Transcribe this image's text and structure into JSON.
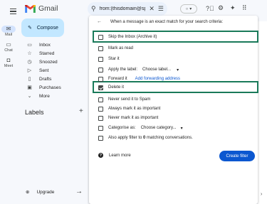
{
  "app": {
    "name": "Gmail"
  },
  "search": {
    "query": "from:(thisdomain@span"
  },
  "rail": [
    {
      "label": "Mail",
      "icon": "mail-icon",
      "glyph": "✉"
    },
    {
      "label": "Chat",
      "icon": "chat-icon",
      "glyph": "▭"
    },
    {
      "label": "Meet",
      "icon": "meet-icon",
      "glyph": "◘"
    }
  ],
  "compose": {
    "label": "Compose"
  },
  "nav": [
    {
      "label": "Inbox",
      "icon": "inbox-icon",
      "glyph": "▭"
    },
    {
      "label": "Starred",
      "icon": "star-icon",
      "glyph": "☆"
    },
    {
      "label": "Snoozed",
      "icon": "clock-icon",
      "glyph": "◷"
    },
    {
      "label": "Sent",
      "icon": "send-icon",
      "glyph": "▷"
    },
    {
      "label": "Drafts",
      "icon": "draft-icon",
      "glyph": "▯"
    },
    {
      "label": "Purchases",
      "icon": "purchases-icon",
      "glyph": "▣"
    },
    {
      "label": "More",
      "icon": "chevron-down-icon",
      "glyph": "⌄"
    }
  ],
  "labels": {
    "title": "Labels"
  },
  "upgrade": {
    "label": "Upgrade"
  },
  "filter": {
    "header": "When a message is an exact match for your search criteria:",
    "options": {
      "skip_inbox": "Skip the Inbox (Archive it)",
      "mark_read": "Mark as read",
      "star": "Star it",
      "apply_label": "Apply the label:",
      "apply_label_value": "Choose label...",
      "forward": "Forward it",
      "forward_link": "Add forwarding address",
      "delete": "Delete it",
      "never_spam": "Never send it to Spam",
      "always_important": "Always mark it as important",
      "never_important": "Never mark it as important",
      "categorise": "Categorise as:",
      "categorise_value": "Choose category...",
      "also_apply_pre": "Also apply filter to",
      "also_apply_count": "0",
      "also_apply_post": "matching conversations."
    },
    "checked": {
      "delete": true
    },
    "learn_more": "Learn more",
    "create": "Create filter"
  },
  "colors": {
    "highlight": "#1a7a5a",
    "primary": "#0b57d0",
    "compose_bg": "#c2e7ff"
  }
}
